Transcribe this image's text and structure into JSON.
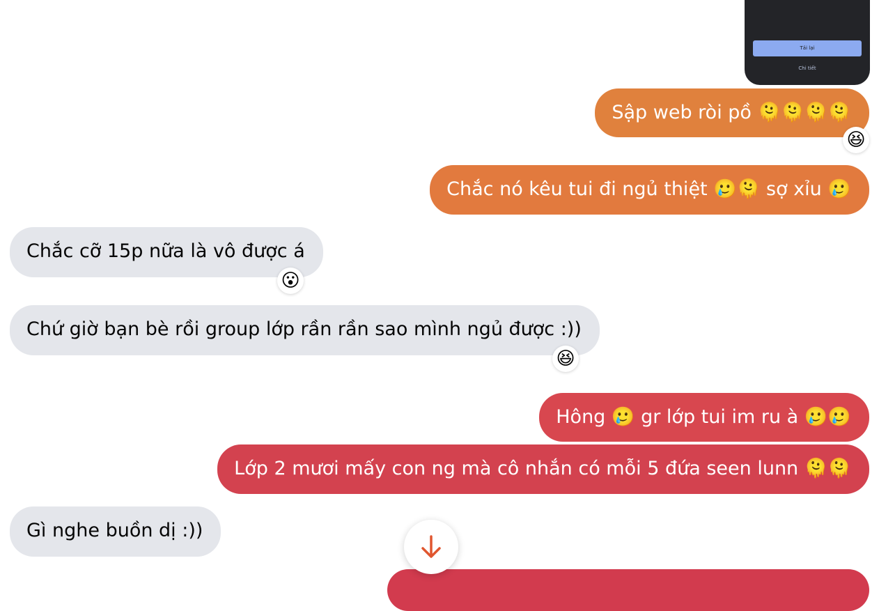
{
  "shared_card": {
    "reload_label": "Tải lại",
    "details_label": "Chi tiết"
  },
  "messages": [
    {
      "text": "Sập web ròi pồ 🫠🫠🫠🫠",
      "from": "me",
      "color": "#e0813d",
      "reaction": "😆"
    },
    {
      "text": "Chắc nó kêu tui đi ngủ thiệt 🥲🫠 sợ xỉu 🥲",
      "from": "me",
      "color": "#e27a3e"
    },
    {
      "text": "Chắc cỡ 15p nữa là vô được á",
      "from": "other",
      "reaction": "😮"
    },
    {
      "text": "Chứ giờ bạn bè rồi group lớp rần rần sao mình ngủ được :))",
      "from": "other",
      "reaction": "😆"
    },
    {
      "text": "Hông 🥲 gr lớp tui im ru à 🥲🥲",
      "from": "me",
      "color": "#d8474f"
    },
    {
      "text": "Lớp 2 mươi mấy con ng mà cô nhắn có mỗi 5 đứa seen lunn 🫠🫠",
      "from": "me",
      "color": "#d3424f"
    },
    {
      "text": "Gì nghe buồn dị :))",
      "from": "other"
    }
  ],
  "scroll_button": {
    "icon": "arrow-down-icon",
    "color": "#e0562f"
  }
}
